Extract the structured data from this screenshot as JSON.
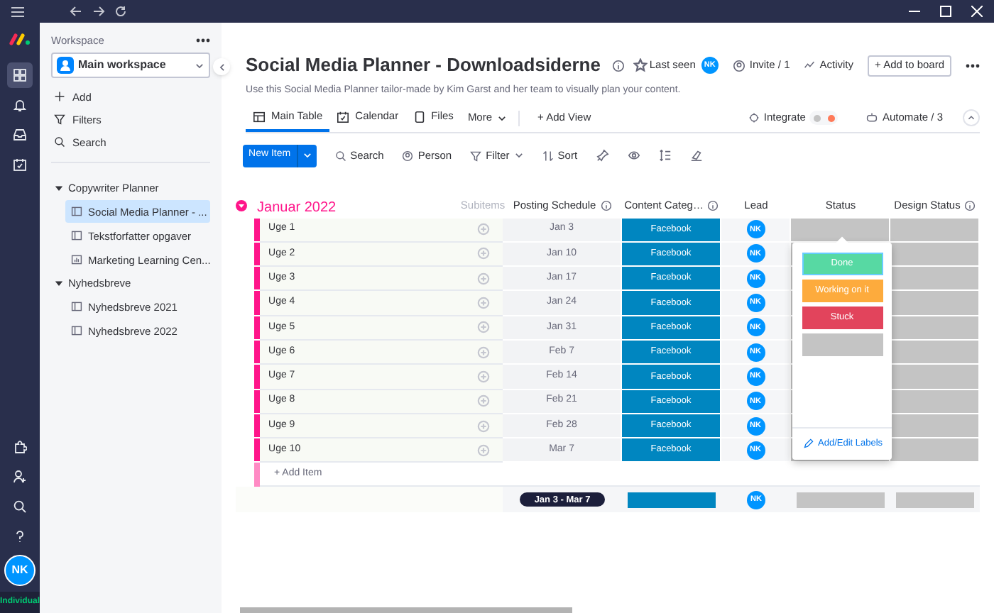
{
  "rail": {
    "top": [
      {
        "kind": "workspaces",
        "selected": true
      },
      {
        "kind": "notifications",
        "selected": false
      },
      {
        "kind": "inbox",
        "selected": false
      },
      {
        "kind": "my-work",
        "selected": false
      }
    ],
    "bottom": [
      {
        "kind": "integrations"
      },
      {
        "kind": "invite"
      },
      {
        "kind": "search"
      },
      {
        "kind": "help"
      }
    ],
    "avatar": "NK",
    "plan": "Individual"
  },
  "sidebar": {
    "label": "Workspace",
    "workspace": "Main workspace",
    "actions": [
      {
        "kind": "add",
        "label": "Add"
      },
      {
        "kind": "filter",
        "label": "Filters"
      },
      {
        "kind": "search",
        "label": "Search"
      }
    ],
    "tree": [
      {
        "label": "Copywriter Planner",
        "expanded": true,
        "children": [
          {
            "label": "Social Media Planner - ...",
            "kind": "board",
            "selected": true
          },
          {
            "label": "Tekstforfatter opgaver",
            "kind": "board",
            "selected": false
          },
          {
            "label": "Marketing Learning Cen...",
            "kind": "dashboard",
            "selected": false
          }
        ]
      },
      {
        "label": "Nyhedsbreve",
        "expanded": true,
        "children": [
          {
            "label": "Nyhedsbreve 2021",
            "kind": "board",
            "selected": false
          },
          {
            "label": "Nyhedsbreve 2022",
            "kind": "board",
            "selected": false
          }
        ]
      }
    ]
  },
  "header": {
    "title": "Social Media Planner - Downloadsiderne",
    "description": "Use this Social Media Planner tailor-made by Kim Garst and her team to visually plan your content.",
    "last_seen": "Last seen",
    "last_seen_avatar": "NK",
    "invite": "Invite / 1",
    "activity": "Activity",
    "add_to_board": "+ Add to board"
  },
  "tabs": [
    {
      "label": "Main Table",
      "selected": true
    },
    {
      "label": "Calendar",
      "selected": false
    },
    {
      "label": "Files",
      "selected": false
    }
  ],
  "view_bar": {
    "more": "More",
    "add_view": "+ Add View",
    "integrate": "Integrate",
    "automate": "Automate / 3"
  },
  "toolbar": {
    "new_item": "New Item",
    "search": "Search",
    "person": "Person",
    "filter": "Filter",
    "sort": "Sort"
  },
  "group": {
    "title": "Januar 2022",
    "expanded": true,
    "columns": [
      {
        "label": "Subitems",
        "info": false
      },
      {
        "label": "Posting Schedule",
        "info": true
      },
      {
        "label": "Content Categ…",
        "info": true
      },
      {
        "label": "Lead",
        "info": false
      },
      {
        "label": "Status",
        "info": false
      },
      {
        "label": "Design Status",
        "info": true
      }
    ],
    "rows": [
      {
        "name": "Uge 1",
        "date": "Jan 3",
        "category": "Facebook",
        "lead": "NK"
      },
      {
        "name": "Uge 2",
        "date": "Jan 10",
        "category": "Facebook",
        "lead": "NK"
      },
      {
        "name": "Uge 3",
        "date": "Jan 17",
        "category": "Facebook",
        "lead": "NK"
      },
      {
        "name": "Uge 4",
        "date": "Jan 24",
        "category": "Facebook",
        "lead": "NK"
      },
      {
        "name": "Uge 5",
        "date": "Jan 31",
        "category": "Facebook",
        "lead": "NK"
      },
      {
        "name": "Uge 6",
        "date": "Feb 7",
        "category": "Facebook",
        "lead": "NK"
      },
      {
        "name": "Uge 7",
        "date": "Feb 14",
        "category": "Facebook",
        "lead": "NK"
      },
      {
        "name": "Uge 8",
        "date": "Feb 21",
        "category": "Facebook",
        "lead": "NK"
      },
      {
        "name": "Uge 9",
        "date": "Feb 28",
        "category": "Facebook",
        "lead": "NK"
      },
      {
        "name": "Uge 10",
        "date": "Mar 7",
        "category": "Facebook",
        "lead": "NK"
      }
    ],
    "add_item": "+ Add Item",
    "summary": {
      "date_range": "Jan 3 - Mar 7",
      "lead": "NK"
    }
  },
  "status_menu": {
    "options": [
      {
        "label": "Done",
        "color": "#57d9a3",
        "selected": true
      },
      {
        "label": "Working on it",
        "color": "#fdab3d",
        "selected": false
      },
      {
        "label": "Stuck",
        "color": "#e2445c",
        "selected": false
      },
      {
        "color": "#c4c4c4",
        "selected": false
      }
    ],
    "edit": "Add/Edit Labels"
  }
}
